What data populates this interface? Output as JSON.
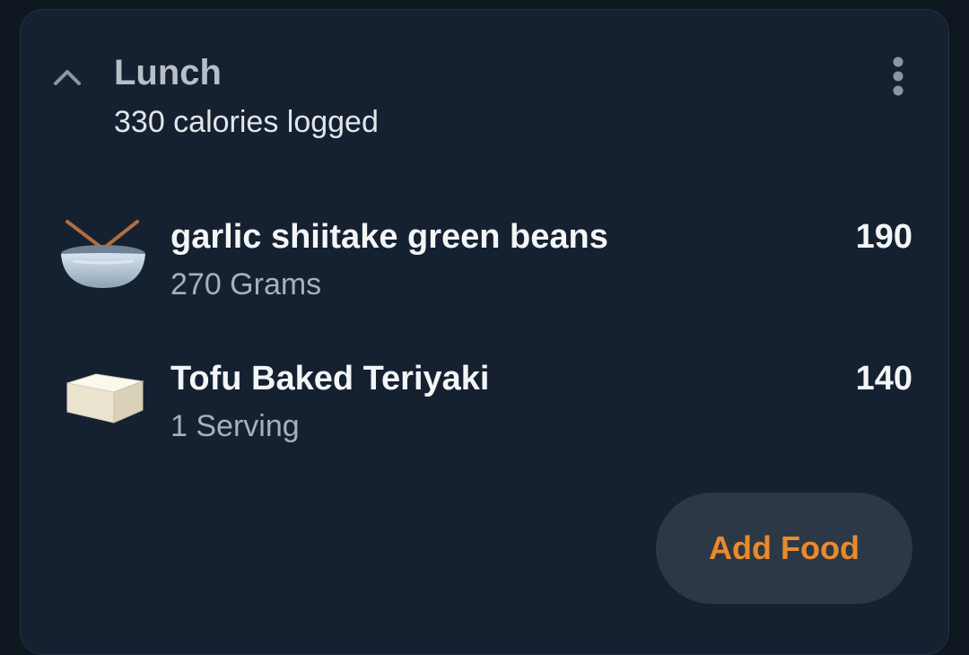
{
  "meal": {
    "title": "Lunch",
    "subtitle": "330 calories logged",
    "collapse_icon": "chevron-up-icon",
    "menu_icon": "more-vertical-icon"
  },
  "foods": [
    {
      "name": "garlic shiitake green beans",
      "quantity": "270 Grams",
      "calories": "190",
      "icon": "bowl-with-chopsticks-icon"
    },
    {
      "name": "Tofu Baked Teriyaki",
      "quantity": "1 Serving",
      "calories": "140",
      "icon": "tofu-icon"
    }
  ],
  "actions": {
    "add_food_label": "Add Food"
  },
  "colors": {
    "background": "#0e1620",
    "card": "#152131",
    "accent": "#ea8a2c",
    "button_bg": "#2c3845"
  }
}
